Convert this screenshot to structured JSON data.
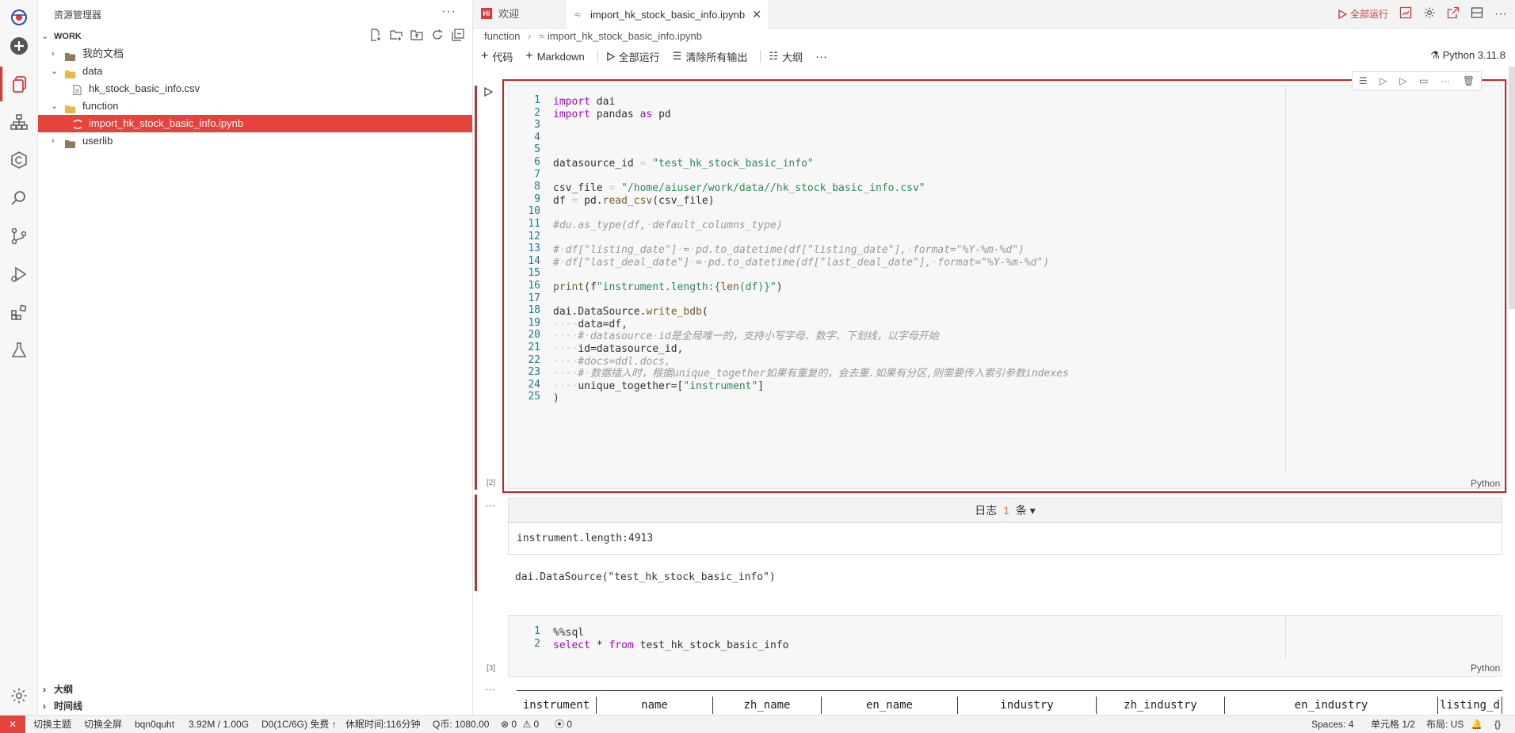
{
  "explorer": {
    "title": "资源管理器",
    "more": "···",
    "workspace": "WORK",
    "tree": [
      {
        "label": "我的文档",
        "type": "folder",
        "expanded": false,
        "depth": 1
      },
      {
        "label": "data",
        "type": "folder",
        "expanded": true,
        "depth": 1
      },
      {
        "label": "hk_stock_basic_info.csv",
        "type": "file",
        "depth": 2
      },
      {
        "label": "function",
        "type": "folder",
        "expanded": true,
        "depth": 1
      },
      {
        "label": "import_hk_stock_basic_info.ipynb",
        "type": "notebook",
        "depth": 2,
        "selected": true
      },
      {
        "label": "userlib",
        "type": "folder",
        "expanded": false,
        "depth": 1
      }
    ],
    "outline": "大纲",
    "timeline": "时间线"
  },
  "tabs": [
    {
      "label": "欢迎",
      "icon": "hi-icon"
    },
    {
      "label": "import_hk_stock_basic_info.ipynb",
      "icon": "jupyter-icon",
      "active": true
    }
  ],
  "tab_actions": {
    "run_all": "全部运行"
  },
  "breadcrumb": [
    "function",
    "import_hk_stock_basic_info.ipynb"
  ],
  "toolbar": {
    "code": "代码",
    "markdown": "Markdown",
    "run_all": "全部运行",
    "clear_outputs": "清除所有输出",
    "outline": "大纲",
    "more": "···"
  },
  "kernel": "Python 3.11.8",
  "cell1": {
    "exec_count": "[2]",
    "language": "Python",
    "lines": [
      "import dai",
      "import pandas as pd",
      "",
      "",
      "",
      "datasource_id = \"test_hk_stock_basic_info\"",
      "",
      "csv_file = \"/home/aiuser/work/data//hk_stock_basic_info.csv\"",
      "df = pd.read_csv(csv_file)",
      "",
      "#du.as_type(df, default_columns_type)",
      "",
      "# df[\"listing_date\"] = pd.to_datetime(df[\"listing_date\"], format=\"%Y-%m-%d\")",
      "# df[\"last_deal_date\"] = pd.to_datetime(df[\"last_deal_date\"], format=\"%Y-%m-%d\")",
      "",
      "print(f\"instrument.length:{len(df)}\")",
      "",
      "dai.DataSource.write_bdb(",
      "    data=df,",
      "    # datasource id是全局唯一的，支持小写字母、数字、下划线，以字母开始",
      "    id=datasource_id,",
      "    #docs=ddl.docs,",
      "    # 数据插入时，根据unique_together如果有重复的，会去重.如果有分区,则需要传入索引参数indexes",
      "    unique_together=[\"instrument\"]",
      ")"
    ],
    "output": {
      "log_label": "日志",
      "log_count": "1",
      "log_unit": "条",
      "log_text": "instrument.length:4913",
      "result": "dai.DataSource(\"test_hk_stock_basic_info\")"
    }
  },
  "cell2": {
    "exec_count": "[3]",
    "language": "Python",
    "lines": [
      "%%sql",
      "select * from test_hk_stock_basic_info"
    ],
    "table_headers": [
      "instrument",
      "name",
      "zh_name",
      "en_name",
      "industry",
      "zh_industry",
      "en_industry",
      "listing_d"
    ]
  },
  "statusbar": {
    "theme": "切换主题",
    "fullscreen": "切换全屏",
    "user": "bqn0quht",
    "memory": "3.92M / 1.00G",
    "resource": "D0(1C/6G) 免费 ↑",
    "sleep": "休眠时间:116分钟",
    "coins": "Q币: 1080.00",
    "errors": "0",
    "warnings": "0",
    "ports": "0",
    "spaces": "Spaces: 4",
    "cell_pos": "单元格 1/2",
    "layout": "布局: US"
  }
}
